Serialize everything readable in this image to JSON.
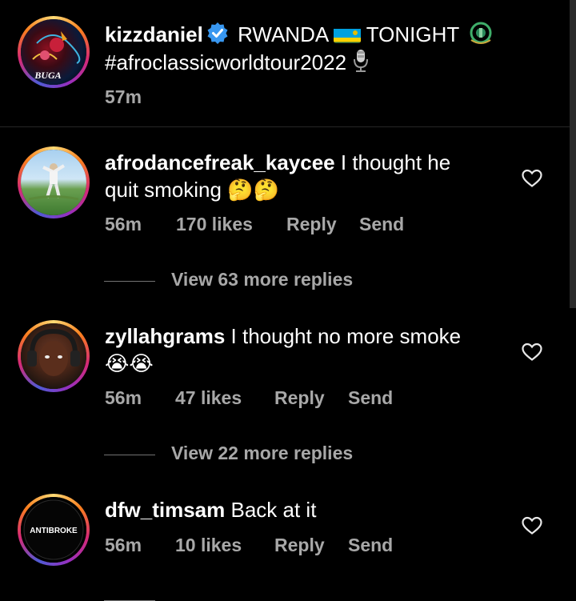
{
  "post": {
    "username": "kizzdaniel",
    "caption_part1": "RWANDA",
    "caption_part2": "TONIGHT",
    "hashtag": "#afroclassicworldtour2022",
    "time": "57m",
    "avatar_logo_text": "BUGA"
  },
  "comments": [
    {
      "username": "afrodancefreak_kaycee",
      "text_line1": "I thought he",
      "text_line2": "quit smoking",
      "emojis": "🤔🤔",
      "time": "56m",
      "likes": "170 likes",
      "reply": "Reply",
      "send": "Send",
      "view_replies": "View 63 more replies"
    },
    {
      "username": "zyllahgrams",
      "text_line1": "I thought no more smoke",
      "emojis": "😭😭",
      "time": "56m",
      "likes": "47 likes",
      "reply": "Reply",
      "send": "Send",
      "view_replies": "View 22 more replies"
    },
    {
      "username": "dfw_timsam",
      "text_line1": "Back at it",
      "avatar_logo_text": "ANTIBROKE",
      "time": "56m",
      "likes": "10 likes",
      "reply": "Reply",
      "send": "Send"
    }
  ],
  "colors": {
    "background": "#000000",
    "secondary_text": "#a8a8a8",
    "verified_blue": "#3897f0",
    "divider": "#262626"
  },
  "icons": [
    "verified-badge-icon",
    "rwanda-flag-icon",
    "rwanda-emblem-icon",
    "microphone-icon",
    "heart-outline-icon"
  ]
}
